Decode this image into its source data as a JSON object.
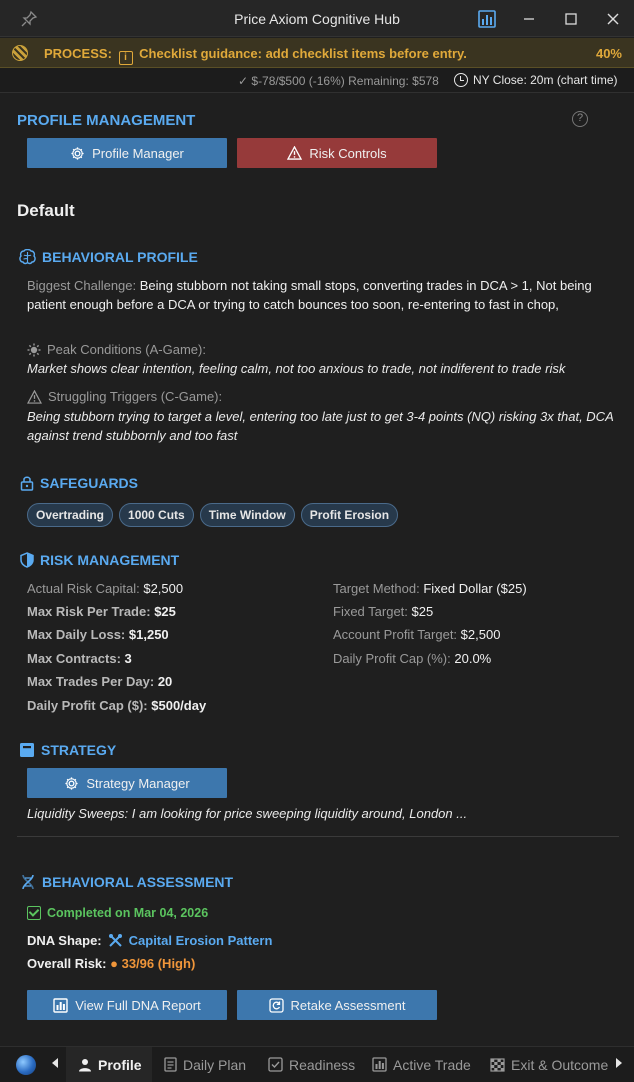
{
  "window": {
    "title": "Price Axiom Cognitive Hub"
  },
  "process_bar": {
    "label": "PROCESS:",
    "message": "Checklist guidance: add checklist items before entry.",
    "percent": "40%"
  },
  "status": {
    "remaining": "✓ $-78/$500 (-16%) Remaining: $578",
    "ny_close": "NY Close: 20m (chart time)"
  },
  "profile_management": {
    "title": "PROFILE MANAGEMENT",
    "help": "?",
    "profile_manager_label": "Profile Manager",
    "risk_controls_label": "Risk Controls",
    "profile_name": "Default"
  },
  "behavioral_profile": {
    "title": "BEHAVIORAL PROFILE",
    "challenge_label": "Biggest Challenge:",
    "challenge_text": "Being stubborn not taking small stops, converting trades in DCA > 1, Not being patient enough before a DCA or trying to catch bounces too soon, re-entering to fast in chop,",
    "peak_label": "Peak Conditions (A-Game):",
    "peak_text": "Market shows clear intention, feeling calm, not too anxious to trade, not indiferent to trade risk",
    "struggle_label": "Struggling Triggers (C-Game):",
    "struggle_text": "Being stubborn trying to target a level, entering too late just to get 3-4 points (NQ) risking 3x that, DCA against trend stubbornly and too fast"
  },
  "safeguards": {
    "title": "SAFEGUARDS",
    "chips": [
      "Overtrading",
      "1000 Cuts",
      "Time Window",
      "Profit Erosion"
    ]
  },
  "risk_management": {
    "title": "RISK MANAGEMENT",
    "left": [
      {
        "label": "Actual Risk Capital:",
        "value": "$2,500"
      },
      {
        "label": "Max Risk Per Trade:",
        "value": "$25"
      },
      {
        "label": "Max Daily Loss:",
        "value": "$1,250"
      },
      {
        "label": "Max Contracts:",
        "value": "3"
      },
      {
        "label": "Max Trades Per Day:",
        "value": "20"
      },
      {
        "label": "Daily Profit Cap ($):",
        "value": "$500/day"
      }
    ],
    "right": [
      {
        "label": "Target Method:",
        "value": "Fixed Dollar ($25)"
      },
      {
        "label": "Fixed Target:",
        "value": "$25"
      },
      {
        "label": "Account Profit Target:",
        "value": "$2,500"
      },
      {
        "label": "Daily Profit Cap (%):",
        "value": "20.0%"
      }
    ]
  },
  "strategy": {
    "title": "STRATEGY",
    "manager_label": "Strategy Manager",
    "description": "Liquidity Sweeps: I am looking for price sweeping liquidity around, London ..."
  },
  "assessment": {
    "title": "BEHAVIORAL ASSESSMENT",
    "completed": "Completed on Mar 04, 2026",
    "dna_label": "DNA Shape:",
    "dna_value": "Capital Erosion Pattern",
    "risk_label": "Overall Risk:",
    "risk_value": "● 33/96 (High)",
    "view_report_label": "View Full DNA Report",
    "retake_label": "Retake Assessment"
  },
  "tabs": [
    {
      "label": "Profile",
      "icon": "user-icon",
      "active": true
    },
    {
      "label": "Daily Plan",
      "icon": "document-icon",
      "active": false
    },
    {
      "label": "Readiness",
      "icon": "checkbox-icon",
      "active": false
    },
    {
      "label": "Active Trade",
      "icon": "chart-icon",
      "active": false
    },
    {
      "label": "Exit & Outcome",
      "icon": "checker-flag-icon",
      "active": false
    }
  ],
  "colors": {
    "accent_blue": "#5aaaf0",
    "button_blue": "#3d77ad",
    "button_red": "#963a3a",
    "process_amber": "#e0a93a",
    "success_green": "#5bc45f",
    "risk_orange": "#f0963a"
  }
}
